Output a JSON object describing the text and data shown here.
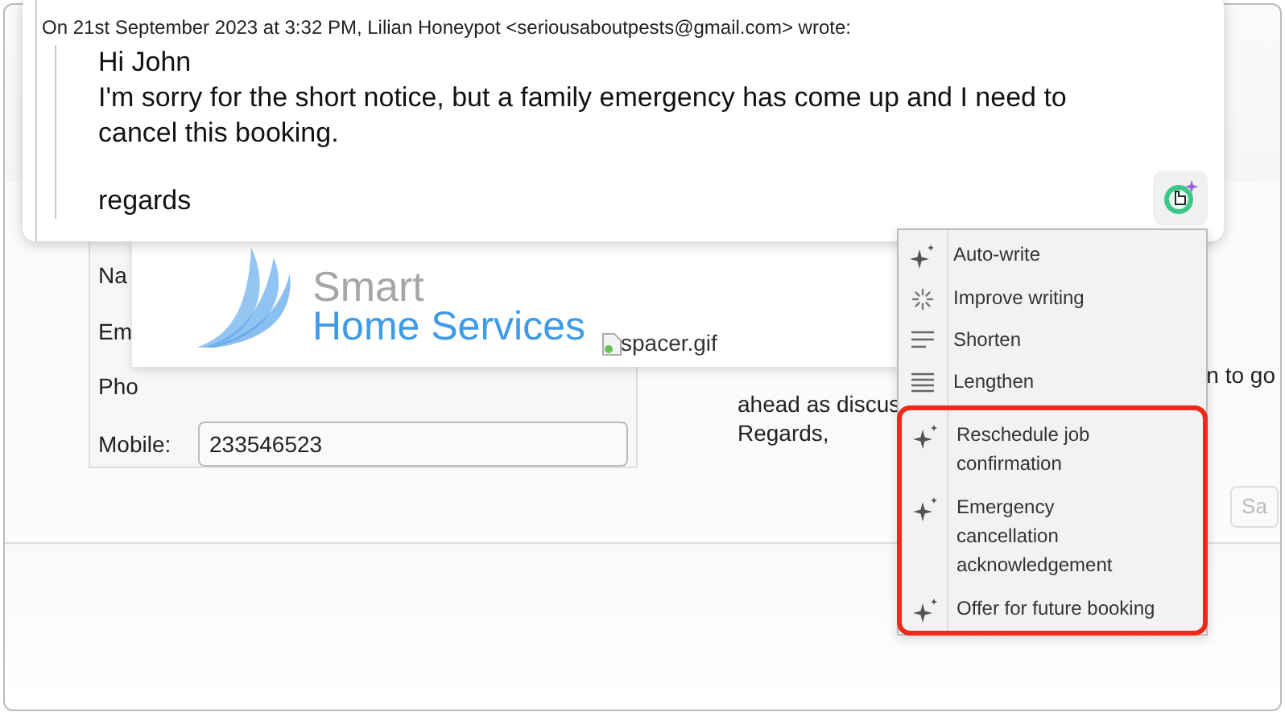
{
  "contact_form": {
    "fields": [
      {
        "label": "Na"
      },
      {
        "label": "Em"
      },
      {
        "label": "Pho"
      },
      {
        "label": "Mobile:",
        "value": "233546523"
      }
    ]
  },
  "message_preview": {
    "lines": [
      "n to go",
      "ahead as discus",
      "Regards,"
    ]
  },
  "save_button": "Sa",
  "logo": {
    "line_1": "Smart",
    "line_2": "Home Services"
  },
  "broken_image": {
    "alt": "spacer.gif"
  },
  "email_quote": {
    "header": "On 21st September 2023 at 3:32 PM, Lilian Honeypot <seriousaboutpests@gmail.com> wrote:",
    "paragraphs": [
      "Hi John",
      "I'm sorry for the short notice, but a family emergency has come up and I need to cancel this booking."
    ],
    "sign_off": "regards"
  },
  "ai_menu": {
    "actions": [
      {
        "label": "Auto-write",
        "kind": "sparkle"
      },
      {
        "label": "Improve writing",
        "kind": "burst"
      },
      {
        "label": "Shorten",
        "kind": "short-lines"
      },
      {
        "label": "Lengthen",
        "kind": "long-lines"
      }
    ],
    "suggestions": [
      {
        "label": "Reschedule job confirmation",
        "kind": "sparkle"
      },
      {
        "label": "Emergency cancellation acknowledgement",
        "kind": "sparkle"
      },
      {
        "label": "Offer for future booking",
        "kind": "sparkle"
      }
    ]
  }
}
